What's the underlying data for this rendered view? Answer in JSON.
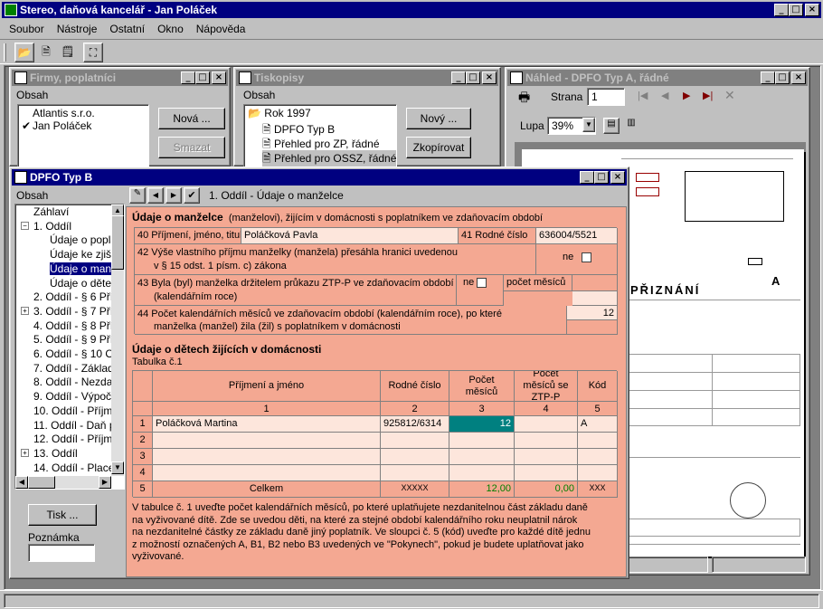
{
  "app": {
    "title": "Stereo, daňová kancelář - Jan Poláček"
  },
  "menu": [
    "Soubor",
    "Nástroje",
    "Ostatní",
    "Okno",
    "Nápověda"
  ],
  "firmy": {
    "title": "Firmy, poplatníci",
    "label": "Obsah",
    "items": [
      "Atlantis s.r.o.",
      "Jan Poláček"
    ],
    "checked_index": 1,
    "new_btn": "Nová ...",
    "delete_btn": "Smazat"
  },
  "tiskopisy": {
    "title": "Tiskopisy",
    "label": "Obsah",
    "root": "Rok 1997",
    "items": [
      "DPFO Typ B",
      "Přehled pro ZP, řádné",
      "Přehled pro OSSZ, řádné"
    ],
    "new_btn": "Nový ...",
    "copy_btn": "Zkopírovat"
  },
  "nahled": {
    "title": "Náhled - DPFO Typ A, řádné",
    "page_label": "Strana",
    "page_value": "1",
    "zoom_label": "Lupa",
    "zoom_value": "39%",
    "form_title": "PŘIZNÁNÍ",
    "form_letter": "A"
  },
  "dpfo": {
    "title": "DPFO Typ B",
    "tree_label": "Obsah",
    "tree": [
      {
        "t": "Záhlaví",
        "lvl": 0
      },
      {
        "t": "1. Oddíl",
        "lvl": 0,
        "exp": "−"
      },
      {
        "t": "Údaje o popla",
        "lvl": 1
      },
      {
        "t": "Údaje ke zjišt",
        "lvl": 1
      },
      {
        "t": "Údaje o manž",
        "lvl": 1,
        "sel": true
      },
      {
        "t": "Údaje o dětec",
        "lvl": 1
      },
      {
        "t": "2. Oddíl - § 6 Příjm",
        "lvl": 0
      },
      {
        "t": "3. Oddíl - § 7 Příjm",
        "lvl": 0,
        "exp": "+"
      },
      {
        "t": "4. Oddíl - § 8 Příjm",
        "lvl": 0
      },
      {
        "t": "5. Oddíl - § 9 Příjm",
        "lvl": 0
      },
      {
        "t": "6. Oddíl - § 10 Os",
        "lvl": 0
      },
      {
        "t": "7. Oddíl - Základ",
        "lvl": 0
      },
      {
        "t": "8. Oddíl - Nezdan",
        "lvl": 0
      },
      {
        "t": "9. Oddíl - Výpoče",
        "lvl": 0
      },
      {
        "t": "10. Oddíl - Příjmy",
        "lvl": 0
      },
      {
        "t": "11. Oddíl - Daň p",
        "lvl": 0
      },
      {
        "t": "12. Oddíl - Příjmy",
        "lvl": 0
      },
      {
        "t": "13. Oddíl",
        "lvl": 0,
        "exp": "+"
      },
      {
        "t": "14. Oddíl - Placer",
        "lvl": 0
      }
    ],
    "print_btn": "Tisk ...",
    "note_label": "Poznámka",
    "breadcrumb": "1. Oddíl - Údaje o manželce",
    "section_title": "Údaje o manželce",
    "section_sub": "(manželovi), žijícím v domácnosti s poplatníkem ve zdaňovacím období",
    "r40_label": "40 Příjmení, jméno, titul",
    "r40_value": "Poláčková Pavla",
    "r41_label": "41 Rodné číslo",
    "r41_value": "636004/5521",
    "r42_label1": "42 Výše vlastního příjmu manželky (manžela) přesáhla hranici uvedenou",
    "r42_label2": "v § 15 odst. 1 písm. c) zákona",
    "r42_ne": "ne",
    "r43_label1": "43 Byla (byl) manželka držitelem průkazu ZTP-P ve zdaňovacím období",
    "r43_label2": "(kalendářním roce)",
    "r43_ne": "ne",
    "r43_months": "počet měsíců",
    "r44_label1": "44 Počet kalendářních měsíců ve zdaňovacím období (kalendářním roce), po které",
    "r44_label2": "manželka (manžel) žila (žil) s poplatníkem v domácnosti",
    "r44_value": "12",
    "kids_title": "Údaje o dětech žijících v domácnosti",
    "table_caption": "Tabulka č.1",
    "cols": [
      "Příjmení a jméno",
      "Rodné číslo",
      "Počet měsíců",
      "Počet měsíců se ZTP-P",
      "Kód"
    ],
    "colnums": [
      "1",
      "2",
      "3",
      "4",
      "5"
    ],
    "rows": [
      {
        "n": "1",
        "name": "Poláčková Martina",
        "rc": "925812/6314",
        "months": "12",
        "ztp": "",
        "code": "A"
      },
      {
        "n": "2",
        "name": "",
        "rc": "",
        "months": "",
        "ztp": "",
        "code": ""
      },
      {
        "n": "3",
        "name": "",
        "rc": "",
        "months": "",
        "ztp": "",
        "code": ""
      },
      {
        "n": "4",
        "name": "",
        "rc": "",
        "months": "",
        "ztp": "",
        "code": ""
      }
    ],
    "total": {
      "n": "5",
      "label": "Celkem",
      "rc": "XXXXX",
      "months": "12,00",
      "ztp": "0,00",
      "code": "XXX"
    },
    "note": [
      "V tabulce č. 1 uveďte počet kalendářních měsíců, po které uplatňujete nezdanitelnou část základu daně",
      "na vyživované dítě. Zde se uvedou děti, na které za stejné období kalendářního roku neuplatnil nárok",
      "na nezdanitelné částky ze základu daně jiný  poplatník.  Ve  sloupci  č. 5 (kód) uveďte pro každé dítě jednu",
      "z  možností označených A, B1, B2 nebo B3 uvedených ve \"Pokynech\", pokud je budete uplatňovat jako",
      "vyživované."
    ]
  },
  "colors": {
    "form_bg": "#f4a892",
    "accent_cell": "#008080",
    "titlebar_active": "#000080"
  }
}
